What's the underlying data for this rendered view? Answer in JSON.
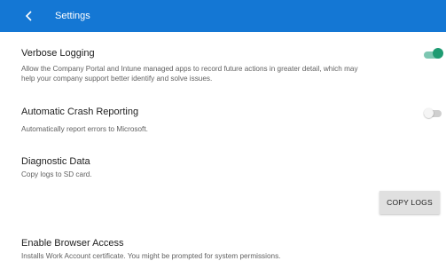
{
  "appbar": {
    "title": "Settings",
    "back_icon": "chevron-left-icon",
    "background_color": "#1477d4"
  },
  "settings": {
    "verbose_logging": {
      "heading": "Verbose Logging",
      "description_line1": "Allow the Company Portal and Intune managed apps to record future actions in greater detail, which may",
      "description_line2": "help your company support better identify and solve issues.",
      "enabled": true
    },
    "crash_reporting": {
      "heading": "Automatic Crash Reporting",
      "description": "Automatically report errors to Microsoft.",
      "enabled": false
    },
    "diagnostic_data": {
      "heading": "Diagnostic Data",
      "description": "Copy logs to SD card.",
      "button_label": "COPY LOGS"
    },
    "browser_access": {
      "heading": "Enable Browser Access",
      "description": "Installs Work Account certificate. You might be prompted for system permissions."
    }
  },
  "colors": {
    "toggle_on": "#1e9b72",
    "toggle_off": "#cfcfcf"
  }
}
